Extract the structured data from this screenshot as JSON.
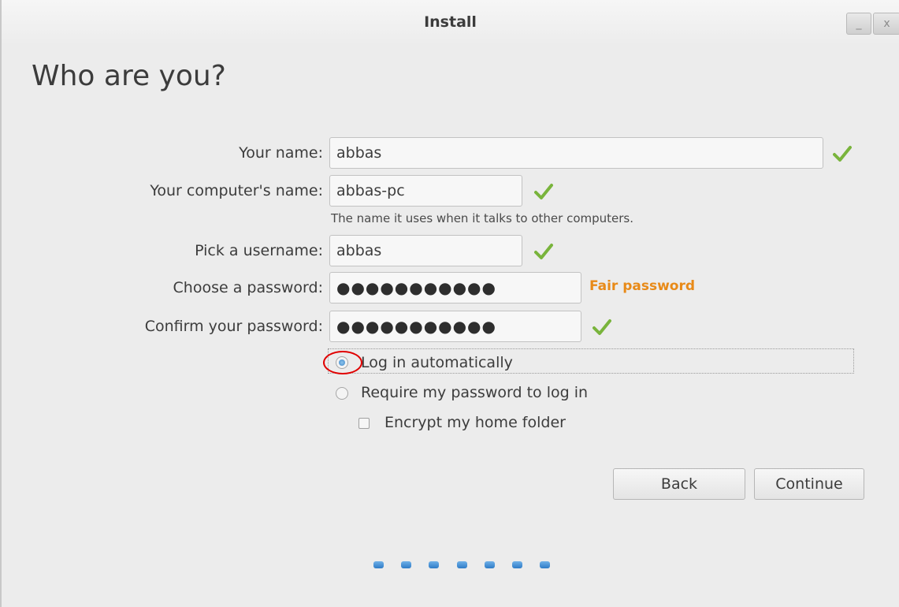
{
  "window": {
    "title": "Install",
    "minimize_glyph": "_",
    "close_glyph": "x"
  },
  "page": {
    "heading": "Who are you?"
  },
  "form": {
    "name_label": "Your name:",
    "name_value": "abbas",
    "computer_label": "Your computer's name:",
    "computer_value": "abbas-pc",
    "computer_hint": "The name it uses when it talks to other computers.",
    "username_label": "Pick a username:",
    "username_value": "abbas",
    "password_label": "Choose a password:",
    "password_mask": "●●●●●●●●●●●",
    "password_strength": "Fair password",
    "confirm_label": "Confirm your password:",
    "confirm_mask": "●●●●●●●●●●●"
  },
  "options": {
    "login_auto": "Log in automatically",
    "login_auto_selected": true,
    "require_password": "Require my password to log in",
    "require_password_selected": false,
    "encrypt_home": "Encrypt my home folder",
    "encrypt_home_checked": false
  },
  "buttons": {
    "back": "Back",
    "continue": "Continue"
  },
  "progress": {
    "step_count": 7
  },
  "colors": {
    "accent": "#3f88c9",
    "strength_fair": "#e88a18",
    "check_green": "#79b43c",
    "annotation_red": "#e00000"
  }
}
